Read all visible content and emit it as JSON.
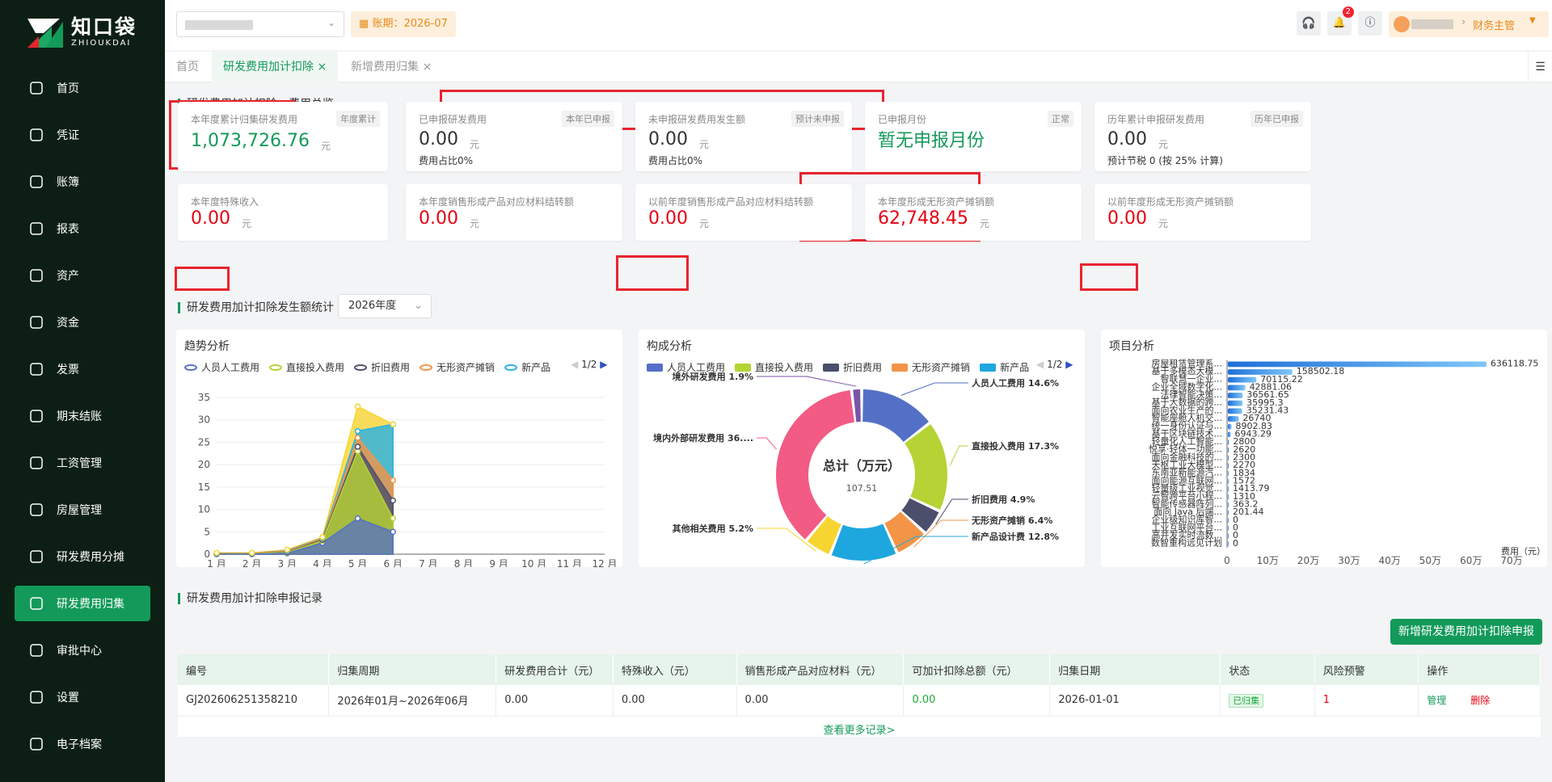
{
  "brand": {
    "cn": "知口袋",
    "en": "ZHIOUKDAI"
  },
  "nav": [
    {
      "label": "首页",
      "icon": "home-icon"
    },
    {
      "label": "凭证",
      "icon": "voucher-icon"
    },
    {
      "label": "账簿",
      "icon": "ledger-icon"
    },
    {
      "label": "报表",
      "icon": "report-icon"
    },
    {
      "label": "资产",
      "icon": "asset-icon"
    },
    {
      "label": "资金",
      "icon": "fund-icon"
    },
    {
      "label": "发票",
      "icon": "invoice-icon"
    },
    {
      "label": "期末结账",
      "icon": "closing-icon"
    },
    {
      "label": "工资管理",
      "icon": "salary-icon"
    },
    {
      "label": "房屋管理",
      "icon": "house-icon"
    },
    {
      "label": "研发费用分摊",
      "icon": "allocation-icon"
    },
    {
      "label": "研发费用归集",
      "icon": "collection-icon",
      "active": true
    },
    {
      "label": "审批中心",
      "icon": "approval-icon"
    },
    {
      "label": "设置",
      "icon": "settings-icon"
    },
    {
      "label": "电子档案",
      "icon": "archive-icon"
    }
  ],
  "topbar": {
    "period": "账期：2026-07",
    "role": "财务主管",
    "badge": "2"
  },
  "tabs": [
    {
      "label": "首页"
    },
    {
      "label": "研发费用加计扣除",
      "close": "×"
    },
    {
      "label": "新增费用归集",
      "close": "×"
    }
  ],
  "overview": {
    "title": "研发费用加计扣除 - 费用总览",
    "row1": [
      {
        "label": "本年度累计归集研发费用",
        "tag": "年度累计",
        "value": "1,073,726.76",
        "unit": "元",
        "sub": ""
      },
      {
        "label": "已申报研发费用",
        "tag": "本年已申报",
        "value": "0.00",
        "unit": "元",
        "sub": "费用占比0%"
      },
      {
        "label": "未申报研发费用发生额",
        "tag": "预计未申报",
        "value": "0.00",
        "unit": "元",
        "sub": "费用占比0%"
      },
      {
        "label": "已申报月份",
        "tag": "正常",
        "value": "暂无申报月份",
        "unit": "",
        "sub": ""
      },
      {
        "label": "历年累计申报研发费用",
        "tag": "历年已申报",
        "value": "0.00",
        "unit": "元",
        "sub": "预计节税 0 (按 25% 计算)"
      }
    ],
    "row2": [
      {
        "label": "本年度特殊收入",
        "value": "0.00",
        "unit": "元"
      },
      {
        "label": "本年度销售形成产品对应材料结转额",
        "value": "0.00",
        "unit": "元"
      },
      {
        "label": "以前年度销售形成产品对应材料结转额",
        "value": "0.00",
        "unit": "元"
      },
      {
        "label": "本年度形成无形资产摊销额",
        "value": "62,748.45",
        "unit": "元"
      },
      {
        "label": "以前年度形成无形资产摊销额",
        "value": "0.00",
        "unit": "元"
      }
    ]
  },
  "stats": {
    "title": "研发费用加计扣除发生额统计",
    "year": "2026年度"
  },
  "charts_titles": {
    "trend": "趋势分析",
    "composition": "构成分析",
    "project": "项目分析"
  },
  "legend_page": "1/2",
  "chart_data": [
    {
      "type": "area",
      "title": "趋势分析",
      "categories": [
        "1 月",
        "2 月",
        "3 月",
        "4 月",
        "5 月",
        "6 月",
        "7 月",
        "8 月",
        "9 月",
        "10 月",
        "11 月",
        "12 月"
      ],
      "ylim": [
        0,
        35
      ],
      "yticks": [
        0,
        5,
        10,
        15,
        20,
        25,
        30,
        35
      ],
      "series": [
        {
          "name": "人员人工费用",
          "color": "#5470c6",
          "values": [
            0,
            0,
            0.2,
            2.5,
            8,
            5
          ]
        },
        {
          "name": "直接投入费用",
          "color": "#b5d334",
          "values": [
            0.1,
            0.1,
            0.4,
            3,
            23,
            8
          ]
        },
        {
          "name": "折旧费用",
          "color": "#4b4f6b",
          "values": [
            0.1,
            0.1,
            0.5,
            3.2,
            24,
            12
          ]
        },
        {
          "name": "无形资产摊销",
          "color": "#f39447",
          "values": [
            0.2,
            0.2,
            0.7,
            3.5,
            26,
            16.5
          ]
        },
        {
          "name": "新产品设计费",
          "color": "#26b1e6",
          "values": [
            0.2,
            0.2,
            0.8,
            3.6,
            27.5,
            29
          ]
        },
        {
          "name": "其他相关费用",
          "color": "#f7d531",
          "values": [
            0.3,
            0.3,
            1,
            3.8,
            33,
            29
          ]
        }
      ],
      "legend_visible": [
        "人员人工费用",
        "直接投入费用",
        "折旧费用",
        "无形资产摊销",
        "新产品"
      ]
    },
    {
      "type": "pie",
      "title": "构成分析",
      "center_label": "总计（万元）",
      "center_value": "107.51",
      "legend_visible": [
        "人员人工费用",
        "直接投入费用",
        "折旧费用",
        "无形资产摊销",
        "新产品"
      ],
      "slices": [
        {
          "name": "人员人工费用",
          "pct": 14.6,
          "label": "人员人工费用 14.6%",
          "color": "#5470c6"
        },
        {
          "name": "直接投入费用",
          "pct": 17.3,
          "label": "直接投入费用 17.3%",
          "color": "#b5d334"
        },
        {
          "name": "折旧费用",
          "pct": 4.9,
          "label": "折旧费用 4.9%",
          "color": "#4b4f6b"
        },
        {
          "name": "无形资产摊销",
          "pct": 6.4,
          "label": "无形资产摊销 6.4%",
          "color": "#f39447"
        },
        {
          "name": "新产品设计费",
          "pct": 12.8,
          "label": "新产品设计费 12.8%",
          "color": "#1ea7de"
        },
        {
          "name": "其他相关费用",
          "pct": 5.2,
          "label": "其他相关费用 5.2%",
          "color": "#f7d531"
        },
        {
          "name": "境内外部研发费用",
          "pct": 36.9,
          "label": "境内外部研发费用 36....",
          "color": "#f25b84"
        },
        {
          "name": "境外研发费用",
          "pct": 1.9,
          "label": "境外研发费用 1.9%",
          "color": "#7a55a6"
        }
      ]
    },
    {
      "type": "bar",
      "title": "项目分析",
      "xlabel": "费用（元）",
      "xticks": [
        "0",
        "10万",
        "20万",
        "30万",
        "40万",
        "50万",
        "60万",
        "70万"
      ],
      "xlim": [
        0,
        700000
      ],
      "categories": [
        "房屋租赁管理系...",
        "基于多模态大模...",
        "智联慧一企业...",
        "企业全域数字化...",
        "法律智能决策...",
        "基于大数据的跨...",
        "面向农业生产的...",
        "智能座舱人机交...",
        "统一身份认证与...",
        "基于区块链技术...",
        "轻量化人工智能...",
        "悦享·轻体一功能...",
        "面向金融科技的...",
        "天枢工业大模型...",
        "东南亚新能源汽...",
        "面向能源互联网...",
        "轻量级工业视觉...",
        "云智跨平台小程...",
        "智能传感器阵列...",
        "面向 Java 后端...",
        "企业级知识库智...",
        "工业互联网平台...",
        "高并发实时流数...",
        "数智重构远见计划"
      ],
      "values": [
        636118.75,
        158502.18,
        70115.22,
        42881.06,
        36561.65,
        35995.3,
        35231.43,
        26740,
        8902.83,
        6943.29,
        2800,
        2620,
        2300,
        2270,
        1834,
        1572,
        1413.79,
        1310,
        363.2,
        201.44,
        0,
        0,
        0,
        0
      ],
      "labels": [
        "636118.75",
        "158502.18",
        "70115.22",
        "42881.06",
        "36561.65",
        "35995.3",
        "35231.43",
        "26740",
        "8902.83",
        "6943.29",
        "2800",
        "2620",
        "2300",
        "2270",
        "1834",
        "1572",
        "1413.79",
        "1310",
        "363.2",
        "201.44",
        "0",
        "0",
        "0",
        "0"
      ]
    }
  ],
  "records": {
    "title": "研发费用加计扣除申报记录",
    "add_button": "新增研发费用加计扣除申报",
    "headers": [
      "编号",
      "归集周期",
      "研发费用合计（元）",
      "特殊收入（元）",
      "销售形成产品对应材料（元）",
      "可加计扣除总额（元）",
      "归集日期",
      "状态",
      "风险预警",
      "操作"
    ],
    "rows": [
      {
        "id": "GJ202606251358210",
        "period": "2026年01月~2026年06月",
        "total": "0.00",
        "special": "0.00",
        "material": "0.00",
        "deductible": "0.00",
        "date": "2026-01-01",
        "status": "已归集",
        "risk": "1",
        "manage": "管理",
        "delete": "删除"
      }
    ],
    "more": "查看更多记录>"
  }
}
